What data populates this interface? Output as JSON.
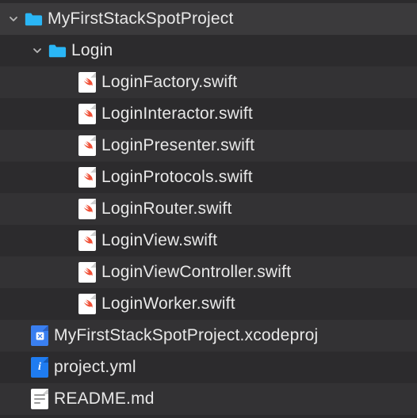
{
  "project": {
    "name": "MyFirstStackSpotProject",
    "folders": [
      {
        "name": "Login",
        "files": [
          "LoginFactory.swift",
          "LoginInteractor.swift",
          "LoginPresenter.swift",
          "LoginProtocols.swift",
          "LoginRouter.swift",
          "LoginView.swift",
          "LoginViewController.swift",
          "LoginWorker.swift"
        ]
      }
    ],
    "root_files": [
      {
        "name": "MyFirstStackSpotProject.xcodeproj",
        "type": "xcodeproj"
      },
      {
        "name": "project.yml",
        "type": "yml"
      },
      {
        "name": "README.md",
        "type": "md"
      }
    ]
  },
  "colors": {
    "folder": "#2ab6f6",
    "swift": "#f05138"
  }
}
